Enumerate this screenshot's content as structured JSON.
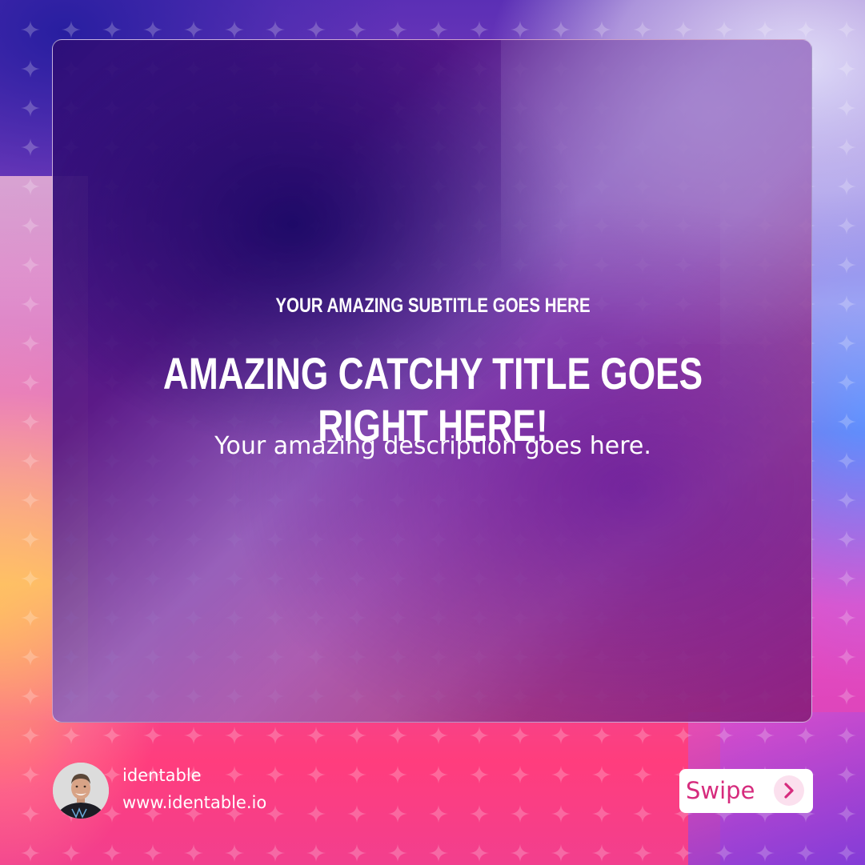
{
  "card": {
    "subtitle": "YOUR AMAZING SUBTITLE GOES HERE",
    "title": "AMAZING CATCHY TITLE GOES RIGHT HERE!",
    "description": "Your amazing description goes here."
  },
  "footer": {
    "author_name": "identable",
    "author_website": "www.identable.io",
    "swipe_label": "Swipe",
    "swipe_icon": "chevron-right-icon",
    "avatar_icon": "avatar-photo"
  },
  "colors": {
    "accent": "#d62b7d",
    "accent_light": "#fbe0ee",
    "text": "#ffffff"
  }
}
